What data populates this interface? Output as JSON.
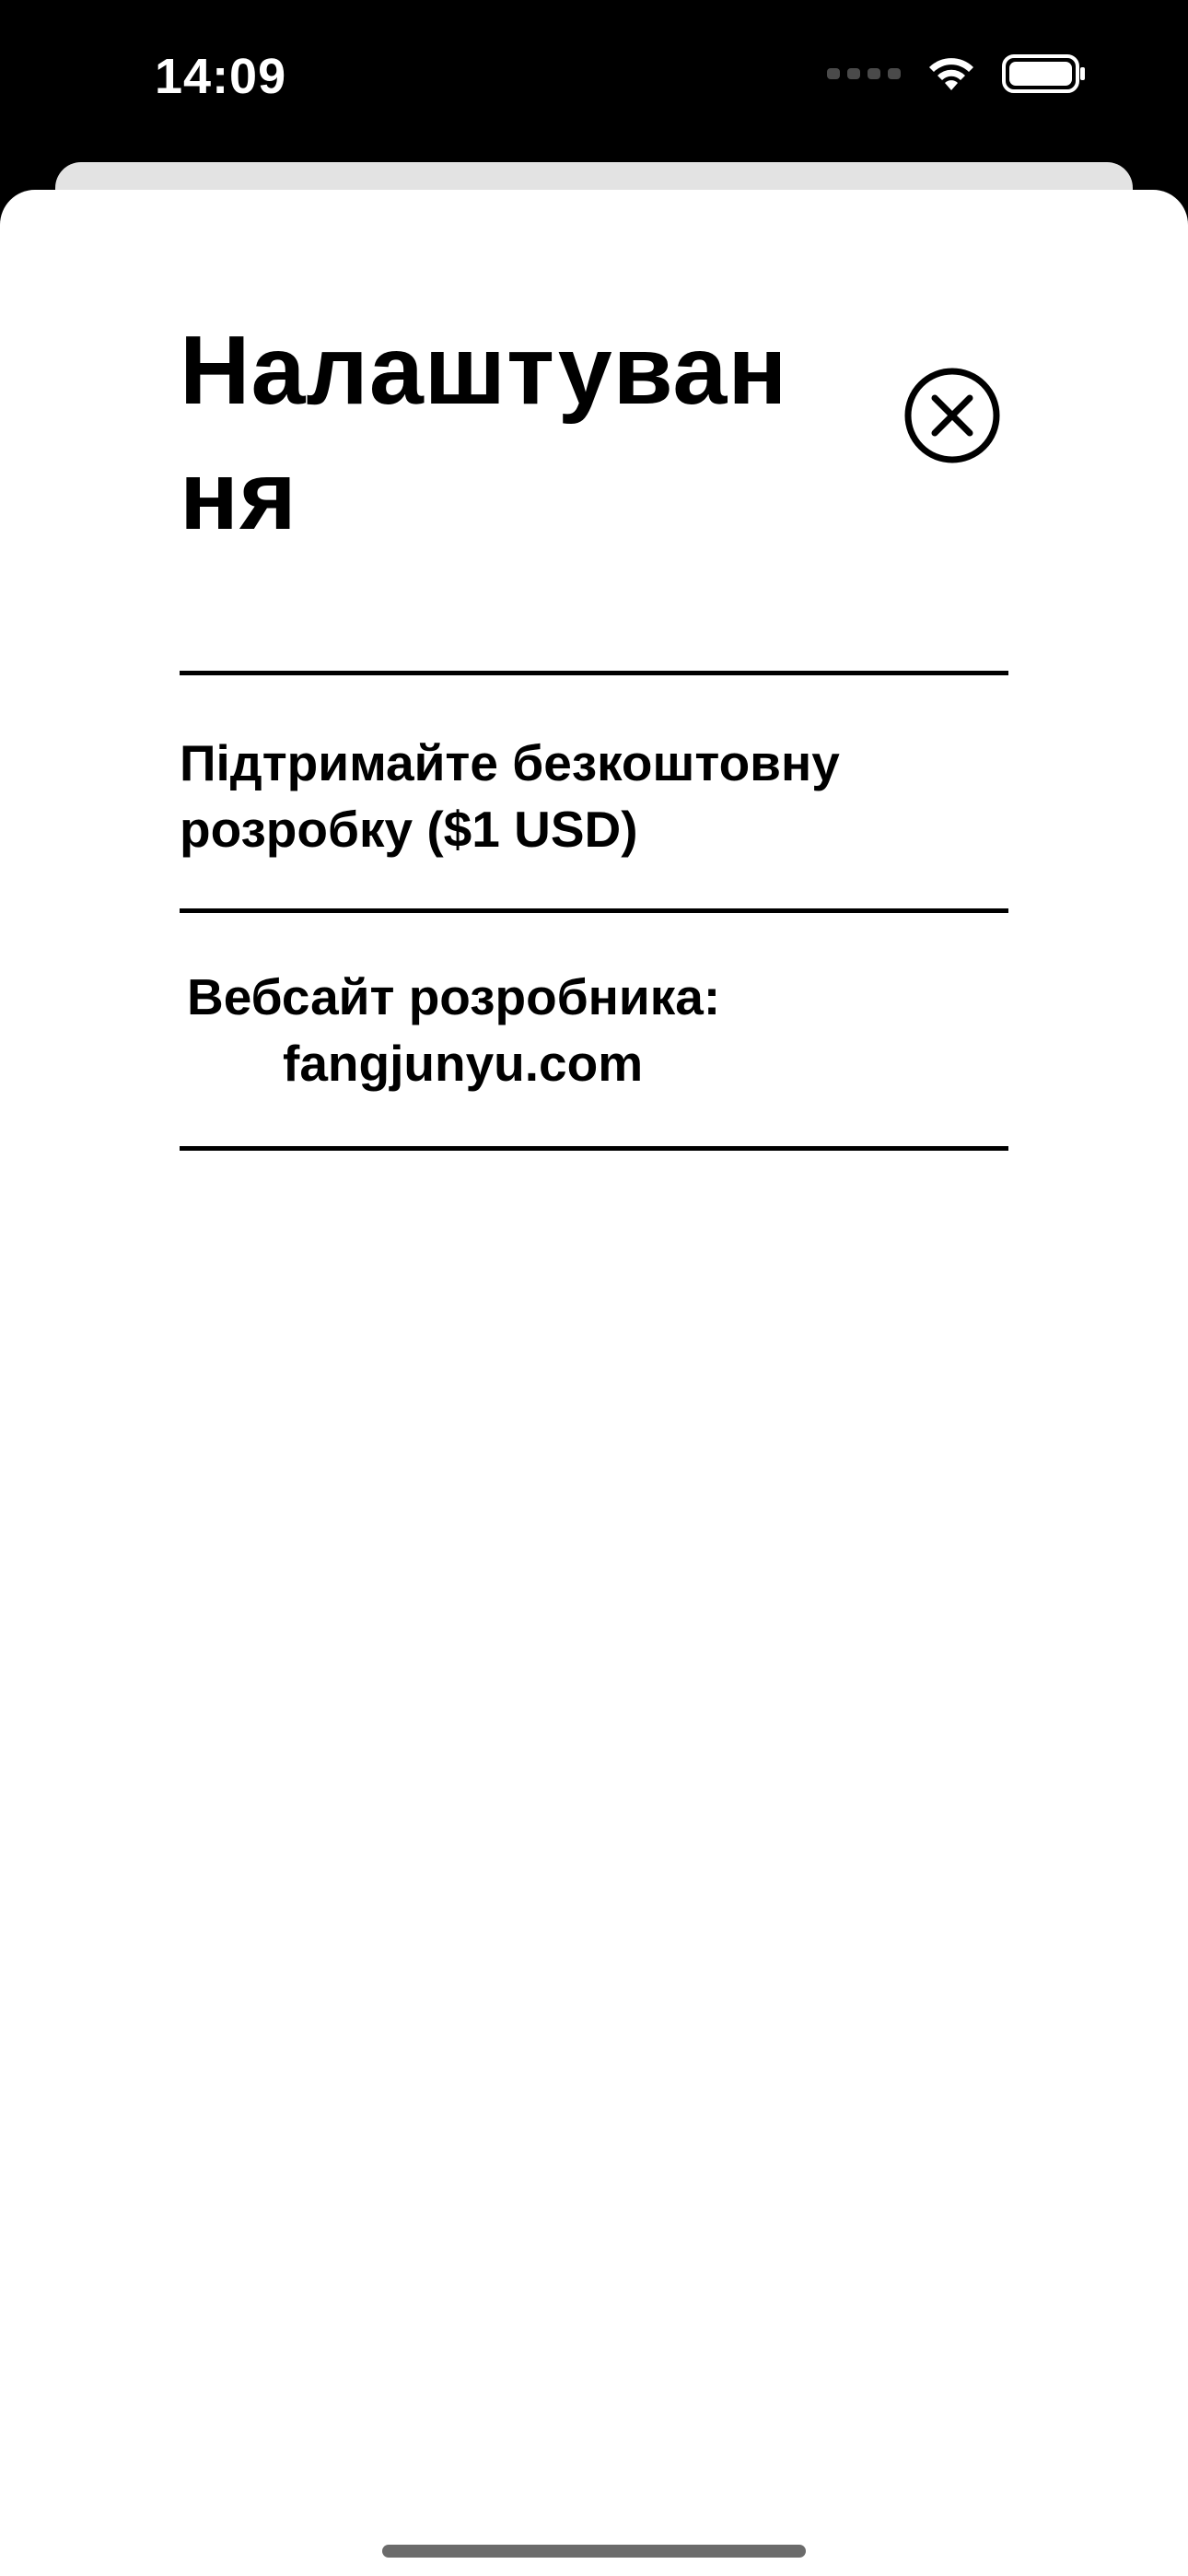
{
  "status_bar": {
    "time": "14:09",
    "icons": [
      "cellular-signal-icon",
      "wifi-icon",
      "battery-icon"
    ]
  },
  "settings": {
    "title": "Налаштування",
    "close_icon": "close-circle-icon",
    "donate_label": "Підтримайте безкоштовну розробку ($1 USD)",
    "website_label": "Вебсайт розробника:",
    "website_url": "fangjunyu.com"
  },
  "colors": {
    "background": "#000000",
    "sheet": "#ffffff",
    "text": "#000000",
    "back_card": "#e3e3e3"
  }
}
